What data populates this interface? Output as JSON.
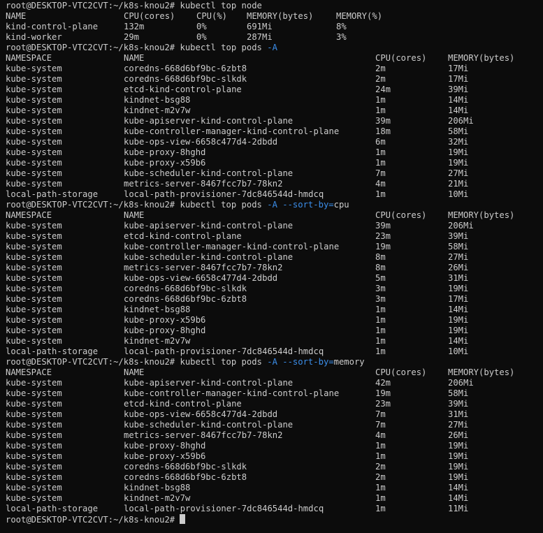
{
  "prompt": "root@DESKTOP-VTC2CVT:~/k8s-knou2#",
  "colors": {
    "background": "#0c0c0c",
    "text": "#cccccc",
    "flag": "#3b8eea"
  },
  "top_node": {
    "command": {
      "base": "kubectl top node",
      "flags": ""
    },
    "headers": [
      "NAME",
      "CPU(cores)",
      "CPU(%)",
      "MEMORY(bytes)",
      "MEMORY(%)"
    ],
    "rows": [
      [
        "kind-control-plane",
        "132m",
        "0%",
        "691Mi",
        "8%"
      ],
      [
        "kind-worker",
        "29m",
        "0%",
        "287Mi",
        "3%"
      ]
    ]
  },
  "top_pods": {
    "command": {
      "base": "kubectl top pods",
      "flags": "-A"
    },
    "headers": [
      "NAMESPACE",
      "NAME",
      "CPU(cores)",
      "MEMORY(bytes)"
    ],
    "rows": [
      [
        "kube-system",
        "coredns-668d6bf9bc-6zbt8",
        "2m",
        "17Mi"
      ],
      [
        "kube-system",
        "coredns-668d6bf9bc-slkdk",
        "2m",
        "17Mi"
      ],
      [
        "kube-system",
        "etcd-kind-control-plane",
        "24m",
        "39Mi"
      ],
      [
        "kube-system",
        "kindnet-bsg88",
        "1m",
        "14Mi"
      ],
      [
        "kube-system",
        "kindnet-m2v7w",
        "1m",
        "14Mi"
      ],
      [
        "kube-system",
        "kube-apiserver-kind-control-plane",
        "39m",
        "206Mi"
      ],
      [
        "kube-system",
        "kube-controller-manager-kind-control-plane",
        "18m",
        "58Mi"
      ],
      [
        "kube-system",
        "kube-ops-view-6658c477d4-2dbdd",
        "6m",
        "32Mi"
      ],
      [
        "kube-system",
        "kube-proxy-8hghd",
        "1m",
        "19Mi"
      ],
      [
        "kube-system",
        "kube-proxy-x59b6",
        "1m",
        "19Mi"
      ],
      [
        "kube-system",
        "kube-scheduler-kind-control-plane",
        "7m",
        "27Mi"
      ],
      [
        "kube-system",
        "metrics-server-8467fcc7b7-78kn2",
        "4m",
        "21Mi"
      ],
      [
        "local-path-storage",
        "local-path-provisioner-7dc846544d-hmdcq",
        "1m",
        "10Mi"
      ]
    ]
  },
  "top_pods_cpu": {
    "command": {
      "base": "kubectl top pods",
      "flags": "-A --sort-by=",
      "arg": "cpu"
    },
    "headers": [
      "NAMESPACE",
      "NAME",
      "CPU(cores)",
      "MEMORY(bytes)"
    ],
    "rows": [
      [
        "kube-system",
        "kube-apiserver-kind-control-plane",
        "39m",
        "206Mi"
      ],
      [
        "kube-system",
        "etcd-kind-control-plane",
        "23m",
        "39Mi"
      ],
      [
        "kube-system",
        "kube-controller-manager-kind-control-plane",
        "19m",
        "58Mi"
      ],
      [
        "kube-system",
        "kube-scheduler-kind-control-plane",
        "8m",
        "27Mi"
      ],
      [
        "kube-system",
        "metrics-server-8467fcc7b7-78kn2",
        "8m",
        "26Mi"
      ],
      [
        "kube-system",
        "kube-ops-view-6658c477d4-2dbdd",
        "5m",
        "31Mi"
      ],
      [
        "kube-system",
        "coredns-668d6bf9bc-slkdk",
        "3m",
        "19Mi"
      ],
      [
        "kube-system",
        "coredns-668d6bf9bc-6zbt8",
        "3m",
        "17Mi"
      ],
      [
        "kube-system",
        "kindnet-bsg88",
        "1m",
        "14Mi"
      ],
      [
        "kube-system",
        "kube-proxy-x59b6",
        "1m",
        "19Mi"
      ],
      [
        "kube-system",
        "kube-proxy-8hghd",
        "1m",
        "19Mi"
      ],
      [
        "kube-system",
        "kindnet-m2v7w",
        "1m",
        "14Mi"
      ],
      [
        "local-path-storage",
        "local-path-provisioner-7dc846544d-hmdcq",
        "1m",
        "10Mi"
      ]
    ]
  },
  "top_pods_memory": {
    "command": {
      "base": "kubectl top pods",
      "flags": "-A --sort-by=",
      "arg": "memory"
    },
    "headers": [
      "NAMESPACE",
      "NAME",
      "CPU(cores)",
      "MEMORY(bytes)"
    ],
    "rows": [
      [
        "kube-system",
        "kube-apiserver-kind-control-plane",
        "42m",
        "206Mi"
      ],
      [
        "kube-system",
        "kube-controller-manager-kind-control-plane",
        "19m",
        "58Mi"
      ],
      [
        "kube-system",
        "etcd-kind-control-plane",
        "23m",
        "39Mi"
      ],
      [
        "kube-system",
        "kube-ops-view-6658c477d4-2dbdd",
        "7m",
        "31Mi"
      ],
      [
        "kube-system",
        "kube-scheduler-kind-control-plane",
        "7m",
        "27Mi"
      ],
      [
        "kube-system",
        "metrics-server-8467fcc7b7-78kn2",
        "4m",
        "26Mi"
      ],
      [
        "kube-system",
        "kube-proxy-8hghd",
        "1m",
        "19Mi"
      ],
      [
        "kube-system",
        "kube-proxy-x59b6",
        "1m",
        "19Mi"
      ],
      [
        "kube-system",
        "coredns-668d6bf9bc-slkdk",
        "2m",
        "19Mi"
      ],
      [
        "kube-system",
        "coredns-668d6bf9bc-6zbt8",
        "2m",
        "19Mi"
      ],
      [
        "kube-system",
        "kindnet-bsg88",
        "1m",
        "14Mi"
      ],
      [
        "kube-system",
        "kindnet-m2v7w",
        "1m",
        "14Mi"
      ],
      [
        "local-path-storage",
        "local-path-provisioner-7dc846544d-hmdcq",
        "1m",
        "11Mi"
      ]
    ]
  }
}
